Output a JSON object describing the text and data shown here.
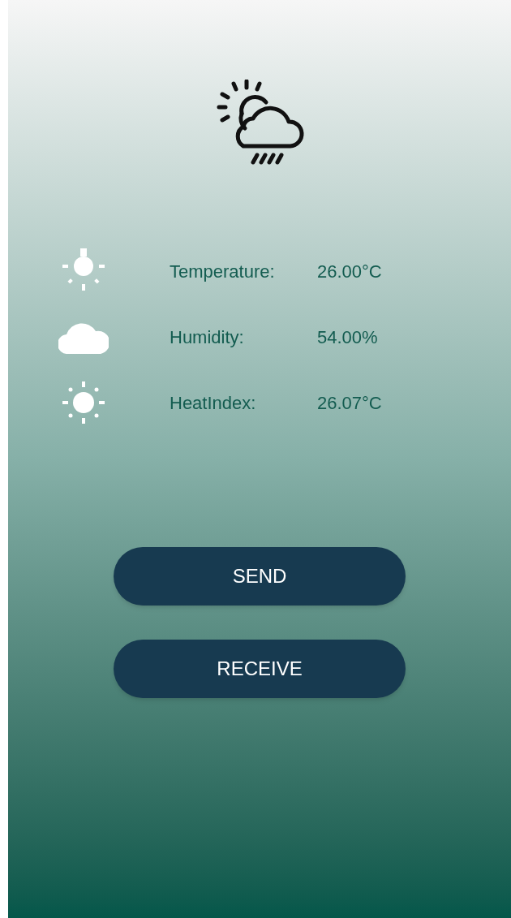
{
  "readings": [
    {
      "kind": "temperature",
      "label": "Temperature:",
      "value": "26.00°C"
    },
    {
      "kind": "humidity",
      "label": "Humidity:",
      "value": "54.00%"
    },
    {
      "kind": "heat_index",
      "label": "HeatIndex:",
      "value": "26.07°C"
    }
  ],
  "buttons": [
    {
      "label": "SEND"
    },
    {
      "label": "RECEIVE"
    }
  ]
}
